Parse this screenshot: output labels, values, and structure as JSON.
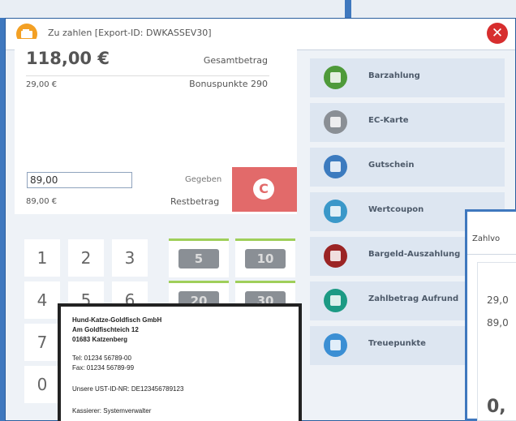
{
  "dialog": {
    "title": "Zu zahlen [Export-ID: DWKASSEV30]",
    "close_label": "✕"
  },
  "summary": {
    "total": "118,00 €",
    "total_label": "Gesamtbetrag",
    "sub_amount": "29,00 €",
    "bonus_label": "Bonuspunkte 290",
    "given_value": "89,00",
    "given_label": "Gegeben",
    "clear_label": "C",
    "rest_amount": "89,00 €",
    "rest_label": "Restbetrag"
  },
  "keypad": {
    "keys": [
      "1",
      "2",
      "3",
      "4",
      "5",
      "6",
      "7",
      "0"
    ]
  },
  "cash": {
    "notes": [
      "5",
      "10",
      "20",
      "30"
    ]
  },
  "payments": [
    {
      "label": "Barzahlung",
      "icon": "cash-register-icon",
      "color": "#4e9a3a"
    },
    {
      "label": "EC-Karte",
      "icon": "card-icon",
      "color": "#8a8f95"
    },
    {
      "label": "Gutschein",
      "icon": "voucher-icon",
      "color": "#3c7bbf"
    },
    {
      "label": "Wertcoupon",
      "icon": "coupon-icon",
      "color": "#3a98c9"
    },
    {
      "label": "Bargeld-Auszahlung",
      "icon": "cash-out-icon",
      "color": "#9b2424"
    },
    {
      "label": "Zahlbetrag Aufrund",
      "icon": "round-up-icon",
      "color": "#1c9a84"
    },
    {
      "label": "Treuepunkte",
      "icon": "loyalty-icon",
      "color": "#3b8fd4"
    }
  ],
  "popup": {
    "title": "Zahlvo",
    "amount1": "29,0",
    "amount2": "89,0",
    "amount3": "0,"
  },
  "receipt": {
    "company": "Hund-Katze-Goldfisch GmbH",
    "street": "Am Goldfischteich 12",
    "city": "01683 Katzenberg",
    "tel": "Tel: 01234 56789-00",
    "fax": "Fax: 01234 56789-99",
    "vat": "Unsere UST-ID-NR: DE123456789123",
    "cashier": "Kassierer: Systemverwalter"
  },
  "colors": {
    "accent": "#3f78be",
    "clear_button": "#e26a6a",
    "cash_highlight": "#9fcf5a",
    "close": "#d72e2e"
  }
}
